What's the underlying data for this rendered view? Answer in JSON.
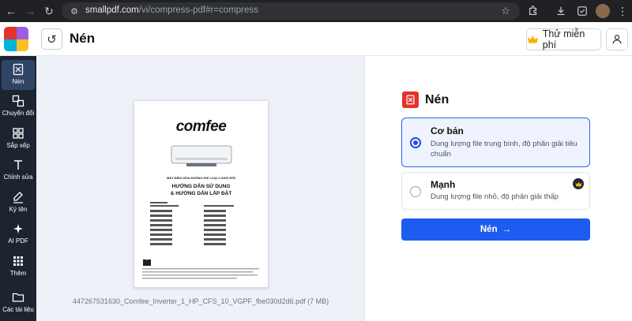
{
  "browser": {
    "url_host": "smallpdf.com",
    "url_path": "/vi/compress-pdf#r=compress"
  },
  "header": {
    "title": "Nén",
    "trial_label": "Thử miễn phí"
  },
  "sidebar": {
    "items": [
      {
        "label": "Nén",
        "icon": "compress-icon"
      },
      {
        "label": "Chuyển đổi",
        "icon": "convert-icon"
      },
      {
        "label": "Sắp xếp",
        "icon": "organize-icon"
      },
      {
        "label": "Chỉnh sửa",
        "icon": "edit-text-icon"
      },
      {
        "label": "Ký tên",
        "icon": "sign-icon"
      },
      {
        "label": "AI PDF",
        "icon": "ai-sparkle-icon"
      },
      {
        "label": "Thêm",
        "icon": "more-grid-icon"
      },
      {
        "label": "Các tài liệu",
        "icon": "folder-icon"
      }
    ]
  },
  "preview": {
    "file_name": "447267531630_Comfee_Inverter_1_HP_CFS_10_VGPF_fbe030d2d6.pdf (7 MB)",
    "doc": {
      "brand": "comfee",
      "line1": "MÁY ĐIỀU HÒA KHÔNG KHÍ LOẠI 2 KHỐI RỜI",
      "line2": "HƯỚNG DẪN SỬ DỤNG",
      "line3": "& HƯỚNG DẪN LẮP ĐẶT"
    }
  },
  "panel": {
    "heading": "Nén",
    "options": [
      {
        "title": "Cơ bản",
        "desc": "Dung lượng file trung bình, độ phân giải tiêu chuẩn",
        "selected": true
      },
      {
        "title": "Mạnh",
        "desc": "Dung lượng file nhỏ, độ phân giải thấp",
        "selected": false
      }
    ],
    "submit_label": "Nén"
  },
  "colors": {
    "accent_blue": "#1e5bef",
    "sidebar_bg": "#1b2430",
    "brand_red": "#e5322d"
  }
}
